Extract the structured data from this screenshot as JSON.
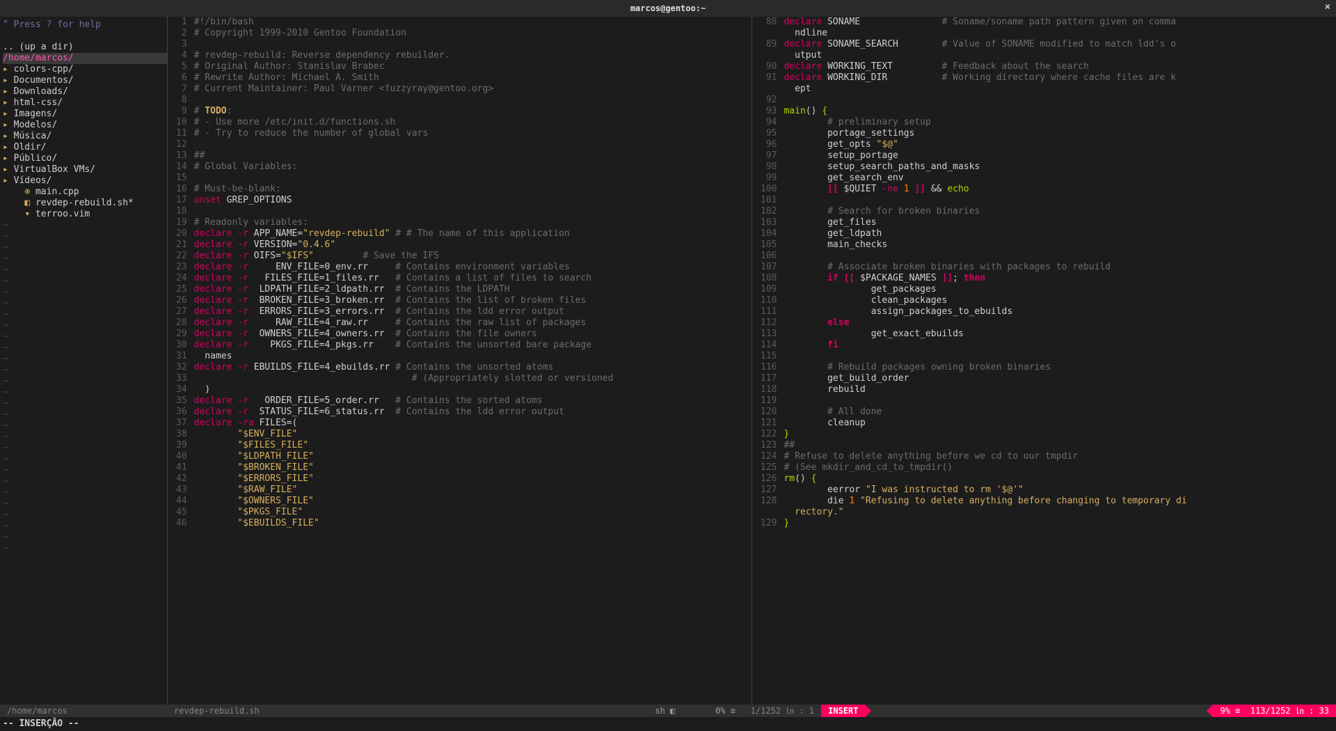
{
  "window": {
    "title": "marcos@gentoo:~"
  },
  "nerdtree": {
    "help": "\" Press ? for help",
    "updir": ".. (up a dir)",
    "cwd": "/home/marcos/",
    "dirs": [
      "colors-cpp/",
      "Documentos/",
      "Downloads/",
      "html-css/",
      "Imagens/",
      "Modelos/",
      "Música/",
      "Oldir/",
      "Público/",
      "VirtualBox VMs/",
      "Vídeos/"
    ],
    "files": [
      {
        "icon": "⊕",
        "name": "main.cpp"
      },
      {
        "icon": "◧",
        "name": "revdep-rebuild.sh*"
      },
      {
        "icon": "▾",
        "name": "terroo.vim"
      }
    ]
  },
  "left_editor": {
    "start": 1,
    "lines": [
      [
        [
          "c-comment",
          "#!/bin/bash"
        ]
      ],
      [
        [
          "c-comment",
          "# Copyright 1999-2010 Gentoo Foundation"
        ]
      ],
      [],
      [
        [
          "c-comment",
          "# revdep-rebuild: Reverse dependency rebuilder."
        ]
      ],
      [
        [
          "c-comment",
          "# Original Author: Stanislav Brabec"
        ]
      ],
      [
        [
          "c-comment",
          "# Rewrite Author: Michael A. Smith"
        ]
      ],
      [
        [
          "c-comment",
          "# Current Maintainer: Paul Varner <fuzzyray@gentoo.org>"
        ]
      ],
      [],
      [
        [
          "c-comment",
          "# "
        ],
        [
          "c-todo",
          "TODO"
        ],
        [
          "c-comment",
          ":"
        ]
      ],
      [
        [
          "c-comment",
          "# - Use more /etc/init.d/functions.sh"
        ]
      ],
      [
        [
          "c-comment",
          "# - Try to reduce the number of global vars"
        ]
      ],
      [],
      [
        [
          "c-comment",
          "##"
        ]
      ],
      [
        [
          "c-comment",
          "# Global Variables:"
        ]
      ],
      [],
      [
        [
          "c-comment",
          "# Must-be-blank:"
        ]
      ],
      [
        [
          "c-declare",
          "unset"
        ],
        [
          "c-var",
          " GREP_OPTIONS"
        ]
      ],
      [],
      [
        [
          "c-comment",
          "# Readonly variables:"
        ]
      ],
      [
        [
          "c-declare",
          "declare"
        ],
        [
          "c-opt",
          " -r"
        ],
        [
          "c-var",
          " APP_NAME="
        ],
        [
          "c-string",
          "\"revdep-rebuild\""
        ],
        [
          "c-comment",
          " # # The name of this application"
        ]
      ],
      [
        [
          "c-declare",
          "declare"
        ],
        [
          "c-opt",
          " -r"
        ],
        [
          "c-var",
          " VERSION="
        ],
        [
          "c-string",
          "\"0.4.6\""
        ]
      ],
      [
        [
          "c-declare",
          "declare"
        ],
        [
          "c-opt",
          " -r"
        ],
        [
          "c-var",
          " OIFS="
        ],
        [
          "c-string",
          "\"$IFS\""
        ],
        [
          "c-comment",
          "         # Save the IFS"
        ]
      ],
      [
        [
          "c-declare",
          "declare"
        ],
        [
          "c-opt",
          " -r"
        ],
        [
          "c-var",
          "     ENV_FILE=0_env.rr     "
        ],
        [
          "c-comment",
          "# Contains environment variables"
        ]
      ],
      [
        [
          "c-declare",
          "declare"
        ],
        [
          "c-opt",
          " -r"
        ],
        [
          "c-var",
          "   FILES_FILE=1_files.rr   "
        ],
        [
          "c-comment",
          "# Contains a list of files to search"
        ]
      ],
      [
        [
          "c-declare",
          "declare"
        ],
        [
          "c-opt",
          " -r"
        ],
        [
          "c-var",
          "  LDPATH_FILE=2_ldpath.rr  "
        ],
        [
          "c-comment",
          "# Contains the LDPATH"
        ]
      ],
      [
        [
          "c-declare",
          "declare"
        ],
        [
          "c-opt",
          " -r"
        ],
        [
          "c-var",
          "  BROKEN_FILE=3_broken.rr  "
        ],
        [
          "c-comment",
          "# Contains the list of broken files"
        ]
      ],
      [
        [
          "c-declare",
          "declare"
        ],
        [
          "c-opt",
          " -r"
        ],
        [
          "c-var",
          "  ERRORS_FILE=3_errors.rr  "
        ],
        [
          "c-comment",
          "# Contains the ldd error output"
        ]
      ],
      [
        [
          "c-declare",
          "declare"
        ],
        [
          "c-opt",
          " -r"
        ],
        [
          "c-var",
          "     RAW_FILE=4_raw.rr     "
        ],
        [
          "c-comment",
          "# Contains the raw list of packages"
        ]
      ],
      [
        [
          "c-declare",
          "declare"
        ],
        [
          "c-opt",
          " -r"
        ],
        [
          "c-var",
          "  OWNERS_FILE=4_owners.rr  "
        ],
        [
          "c-comment",
          "# Contains the file owners"
        ]
      ],
      [
        [
          "c-declare",
          "declare"
        ],
        [
          "c-opt",
          " -r"
        ],
        [
          "c-var",
          "    PKGS_FILE=4_pkgs.rr    "
        ],
        [
          "c-comment",
          "# Contains the unsorted bare package"
        ]
      ],
      [
        [
          "c-var",
          "  names"
        ]
      ],
      [
        [
          "c-declare",
          "declare"
        ],
        [
          "c-opt",
          " -r"
        ],
        [
          "c-var",
          " EBUILDS_FILE=4_ebuilds.rr "
        ],
        [
          "c-comment",
          "# Contains the unsorted atoms"
        ]
      ],
      [
        [
          "c-var",
          "                                        "
        ],
        [
          "c-comment",
          "# (Appropriately slotted or versioned"
        ]
      ],
      [
        [
          "c-var",
          "  )"
        ]
      ],
      [
        [
          "c-declare",
          "declare"
        ],
        [
          "c-opt",
          " -r"
        ],
        [
          "c-var",
          "   ORDER_FILE=5_order.rr   "
        ],
        [
          "c-comment",
          "# Contains the sorted atoms"
        ]
      ],
      [
        [
          "c-declare",
          "declare"
        ],
        [
          "c-opt",
          " -r"
        ],
        [
          "c-var",
          "  STATUS_FILE=6_status.rr  "
        ],
        [
          "c-comment",
          "# Contains the ldd error output"
        ]
      ],
      [
        [
          "c-declare",
          "declare"
        ],
        [
          "c-opt",
          " -ra"
        ],
        [
          "c-var",
          " FILES=("
        ]
      ],
      [
        [
          "c-var",
          "        "
        ],
        [
          "c-string",
          "\"$ENV_FILE\""
        ]
      ],
      [
        [
          "c-var",
          "        "
        ],
        [
          "c-string",
          "\"$FILES_FILE\""
        ]
      ],
      [
        [
          "c-var",
          "        "
        ],
        [
          "c-string",
          "\"$LDPATH_FILE\""
        ]
      ],
      [
        [
          "c-var",
          "        "
        ],
        [
          "c-string",
          "\"$BROKEN_FILE\""
        ]
      ],
      [
        [
          "c-var",
          "        "
        ],
        [
          "c-string",
          "\"$ERRORS_FILE\""
        ]
      ],
      [
        [
          "c-var",
          "        "
        ],
        [
          "c-string",
          "\"$RAW_FILE\""
        ]
      ],
      [
        [
          "c-var",
          "        "
        ],
        [
          "c-string",
          "\"$OWNERS_FILE\""
        ]
      ],
      [
        [
          "c-var",
          "        "
        ],
        [
          "c-string",
          "\"$PKGS_FILE\""
        ]
      ],
      [
        [
          "c-var",
          "        "
        ],
        [
          "c-string",
          "\"$EBUILDS_FILE\""
        ]
      ]
    ]
  },
  "right_editor": {
    "start": 88,
    "lines": [
      [
        [
          "c-declare",
          "declare"
        ],
        [
          "c-var",
          " SONAME               "
        ],
        [
          "c-comment",
          "# Soname/soname path pattern given on comma"
        ]
      ],
      [
        [
          "c-var",
          "  ndline"
        ]
      ],
      [
        [
          "c-declare",
          "declare"
        ],
        [
          "c-var",
          " SONAME_SEARCH        "
        ],
        [
          "c-comment",
          "# Value of SONAME modified to match ldd's o"
        ]
      ],
      [
        [
          "c-var",
          "  utput"
        ]
      ],
      [
        [
          "c-declare",
          "declare"
        ],
        [
          "c-var",
          " WORKING_TEXT         "
        ],
        [
          "c-comment",
          "# Feedback about the search"
        ]
      ],
      [
        [
          "c-declare",
          "declare"
        ],
        [
          "c-var",
          " WORKING_DIR          "
        ],
        [
          "c-comment",
          "# Working directory where cache files are k"
        ]
      ],
      [
        [
          "c-var",
          "  ept"
        ]
      ],
      [],
      [
        [
          "c-func",
          "main"
        ],
        [
          "c-var",
          "() "
        ],
        [
          "c-func",
          "{"
        ]
      ],
      [
        [
          "c-var",
          "        "
        ],
        [
          "c-comment",
          "# preliminary setup"
        ]
      ],
      [
        [
          "c-var",
          "        portage_settings"
        ]
      ],
      [
        [
          "c-var",
          "        get_opts "
        ],
        [
          "c-string",
          "\"$@\""
        ]
      ],
      [
        [
          "c-var",
          "        setup_portage"
        ]
      ],
      [
        [
          "c-var",
          "        setup_search_paths_and_masks"
        ]
      ],
      [
        [
          "c-var",
          "        get_search_env"
        ]
      ],
      [
        [
          "c-var",
          "        "
        ],
        [
          "c-keyword",
          "[["
        ],
        [
          "c-var",
          " $QUIET "
        ],
        [
          "c-op",
          "-ne"
        ],
        [
          "c-num",
          " 1 "
        ],
        [
          "c-keyword",
          "]]"
        ],
        [
          "c-var",
          " && "
        ],
        [
          "c-func",
          "echo"
        ]
      ],
      [],
      [
        [
          "c-var",
          "        "
        ],
        [
          "c-comment",
          "# Search for broken binaries"
        ]
      ],
      [
        [
          "c-var",
          "        get_files"
        ]
      ],
      [
        [
          "c-var",
          "        get_ldpath"
        ]
      ],
      [
        [
          "c-var",
          "        main_checks"
        ]
      ],
      [],
      [
        [
          "c-var",
          "        "
        ],
        [
          "c-comment",
          "# Associate broken binaries with packages to rebuild"
        ]
      ],
      [
        [
          "c-var",
          "        "
        ],
        [
          "c-keyword",
          "if"
        ],
        [
          "c-var",
          " "
        ],
        [
          "c-keyword",
          "[["
        ],
        [
          "c-var",
          " $PACKAGE_NAMES "
        ],
        [
          "c-keyword",
          "]]"
        ],
        [
          "c-var",
          "; "
        ],
        [
          "c-keyword",
          "then"
        ]
      ],
      [
        [
          "c-var",
          "                get_packages"
        ]
      ],
      [
        [
          "c-var",
          "                clean_packages"
        ]
      ],
      [
        [
          "c-var",
          "                assign_packages_to_ebuilds"
        ]
      ],
      [
        [
          "c-var",
          "        "
        ],
        [
          "c-keyword",
          "else"
        ]
      ],
      [
        [
          "c-var",
          "                get_exact_ebuilds"
        ]
      ],
      [
        [
          "c-var",
          "        "
        ],
        [
          "c-keyword",
          "fi"
        ]
      ],
      [],
      [
        [
          "c-var",
          "        "
        ],
        [
          "c-comment",
          "# Rebuild packages owning broken binaries"
        ]
      ],
      [
        [
          "c-var",
          "        get_build_order"
        ]
      ],
      [
        [
          "c-var",
          "        rebuild"
        ]
      ],
      [],
      [
        [
          "c-var",
          "        "
        ],
        [
          "c-comment",
          "# All done"
        ]
      ],
      [
        [
          "c-var",
          "        cleanup"
        ]
      ],
      [
        [
          "c-func",
          "}"
        ]
      ],
      [
        [
          "c-comment",
          "##"
        ]
      ],
      [
        [
          "c-comment",
          "# Refuse to delete anything before we cd to our tmpdir"
        ]
      ],
      [
        [
          "c-comment",
          "# (See mkdir_and_cd_to_tmpdir()"
        ]
      ],
      [
        [
          "c-func",
          "rm"
        ],
        [
          "c-var",
          "() "
        ],
        [
          "c-func",
          "{"
        ]
      ],
      [
        [
          "c-var",
          "        eerror "
        ],
        [
          "c-string",
          "\"I was instructed to rm '$@'\""
        ]
      ],
      [
        [
          "c-var",
          "        die "
        ],
        [
          "c-num",
          "1"
        ],
        [
          "c-string",
          " \"Refusing to delete anything before changing to temporary di"
        ]
      ],
      [
        [
          "c-string",
          "  rectory.\""
        ]
      ],
      [
        [
          "c-func",
          "}"
        ]
      ]
    ],
    "wrap_lines": [
      1,
      3,
      6,
      44
    ]
  },
  "status_left": {
    "path": "/home/marcos"
  },
  "status_mid": {
    "file": "revdep-rebuild.sh",
    "type": "sh ◧",
    "pct": "0% ≡",
    "pos": "1/1252 ㏑ :  1"
  },
  "status_right": {
    "mode": "INSERT",
    "pct": "9% ≡",
    "pos": "113/1252 ㏑ : 33"
  },
  "cmdline": "-- INSERÇÃO --"
}
